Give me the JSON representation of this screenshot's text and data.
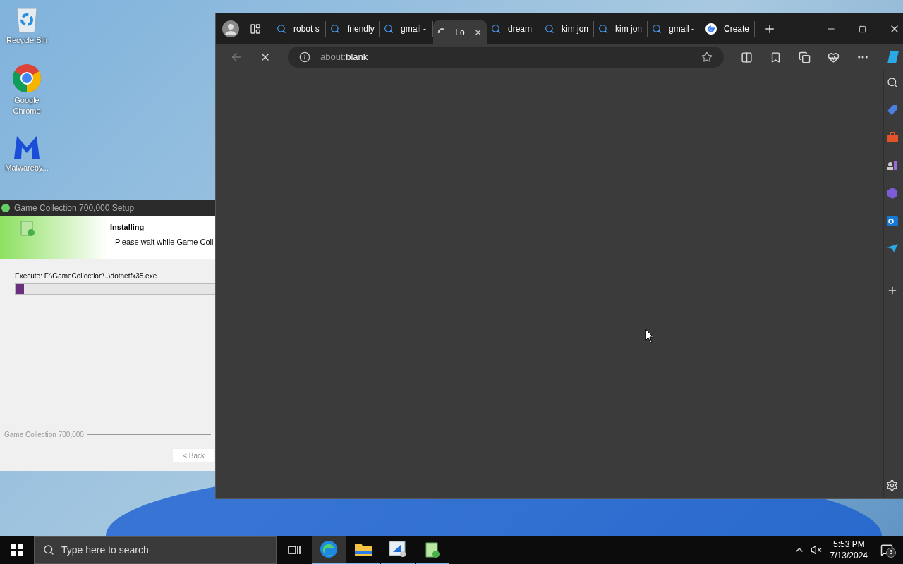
{
  "desktop": {
    "icons": [
      {
        "label": "Recycle Bin",
        "kind": "recycle"
      },
      {
        "label": "Google Chrome",
        "kind": "chrome"
      },
      {
        "label": "Malwareby...",
        "kind": "malware"
      }
    ]
  },
  "installer": {
    "title": "Game Collection 700,000 Setup",
    "heading": "Installing",
    "subtext": "Please wait while Game Coll",
    "detail": "Execute: F:\\GameCollection\\..\\dotnetfx35.exe",
    "progress": {
      "level": 0.04
    },
    "brand": "Game Collection 700,000",
    "back_button": "< Back"
  },
  "browser": {
    "tabs": [
      {
        "label": "robot s",
        "kind": "search",
        "selected": false
      },
      {
        "label": "friendly",
        "kind": "search",
        "selected": false
      },
      {
        "label": "gmail -",
        "kind": "search",
        "selected": false
      },
      {
        "label": "Lo",
        "kind": "loading",
        "selected": true
      },
      {
        "label": "dream",
        "kind": "search",
        "selected": false
      },
      {
        "label": "kim jon",
        "kind": "search",
        "selected": false
      },
      {
        "label": "kim jon",
        "kind": "search",
        "selected": false
      },
      {
        "label": "gmail -",
        "kind": "search",
        "selected": false
      },
      {
        "label": "Create",
        "kind": "google",
        "selected": false
      }
    ],
    "address": {
      "scheme": "about:",
      "rest": "blank"
    }
  },
  "taskbar": {
    "search_placeholder": "Type here to search",
    "apps": [
      {
        "kind": "edge",
        "selected": true
      },
      {
        "kind": "explorer",
        "selected": false
      },
      {
        "kind": "app",
        "selected": false
      },
      {
        "kind": "setup",
        "selected": false
      }
    ],
    "time": "5:53 PM",
    "date": "7/13/2024",
    "notifications": "3"
  }
}
